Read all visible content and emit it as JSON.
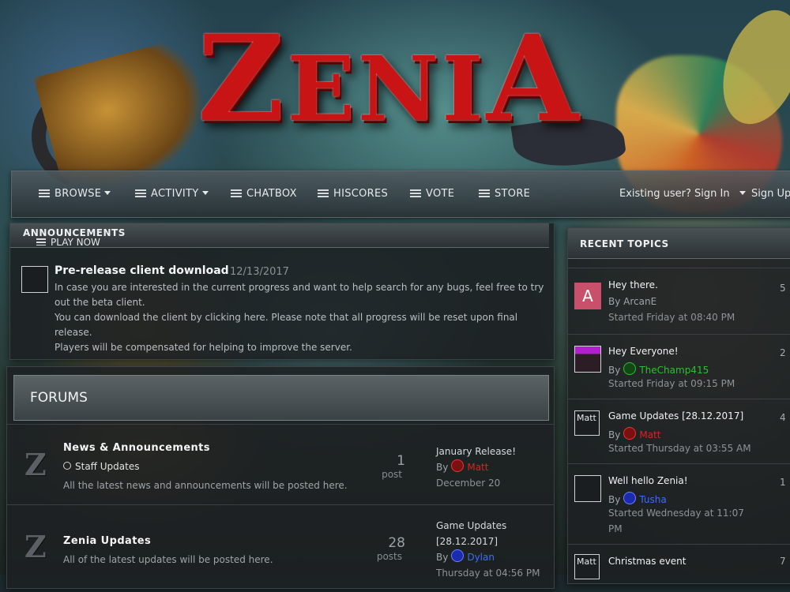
{
  "logo": {
    "text_z": "Z",
    "text_mid": "ENI",
    "text_a": "A"
  },
  "nav": {
    "items": [
      {
        "label": "BROWSE",
        "caret": true
      },
      {
        "label": "ACTIVITY",
        "caret": true
      },
      {
        "label": "CHATBOX",
        "caret": false
      },
      {
        "label": "HISCORES",
        "caret": false
      },
      {
        "label": "VOTE",
        "caret": false
      },
      {
        "label": "STORE",
        "caret": false
      }
    ],
    "sign_in": "Existing user? Sign In",
    "sign_up": "Sign Up"
  },
  "announcements": {
    "heading": "ANNOUNCEMENTS",
    "play_now": "PLAY NOW",
    "title": "Pre-release client download",
    "date": "12/13/2017",
    "body": [
      "In case you are interested in the current progress and want to help search for any bugs, feel free to try",
      "out the beta client.",
      "You can download the client by clicking here.   Please note that all progress will be reset upon final release.",
      "Players will be compensated for helping to improve the server."
    ]
  },
  "forums": {
    "heading": "FORUMS",
    "rows": [
      {
        "name": "News & Announcements",
        "sub": "Staff Updates",
        "desc": "All the latest news and announcements will be posted here.",
        "count": "1",
        "count_label": "post",
        "last_title": "January Release!",
        "last_by_prefix": "By",
        "last_by": "Matt",
        "last_by_color": "#e02020",
        "last_when": "December 20"
      },
      {
        "name": "Zenia Updates",
        "sub": "",
        "desc": "All of the latest updates will be posted here.",
        "count": "28",
        "count_label": "posts",
        "last_title_1": "Game Updates",
        "last_title_2": "[28.12.2017]",
        "last_by_prefix": "By",
        "last_by": "Dylan",
        "last_by_color": "#3a6cff",
        "last_when": "Thursday at 04:56 PM"
      }
    ]
  },
  "recent": {
    "heading": "RECENT TOPICS",
    "items": [
      {
        "avatar_letter": "A",
        "avatar_color": "#c9506a",
        "title": "Hey there.",
        "by_prefix": "By",
        "by": "ArcanE",
        "by_color": "#9ea5a9",
        "started": "Started Friday at 08:40 PM",
        "count": "5"
      },
      {
        "avatar_letter": "",
        "avatar_color": "#9b1fb4",
        "title": "Hey Everyone!",
        "by_prefix": "By",
        "by": "TheChamp415",
        "by_color": "#29c22d",
        "started": "Started Friday at 09:15 PM",
        "count": "2"
      },
      {
        "avatar_letter": "Matt",
        "avatar_color": "#1b1e20",
        "title": "Game Updates [28.12.2017]",
        "by_prefix": "By",
        "by": "Matt",
        "by_color": "#e02020",
        "started": "Started Thursday at 03:55 AM",
        "count": "4"
      },
      {
        "avatar_letter": "",
        "avatar_color": "#1b1e20",
        "title": "Well hello Zenia!",
        "by_prefix": "By",
        "by": "Tusha",
        "by_color": "#3a6cff",
        "started_1": "Started Wednesday at 11:07",
        "started_2": "PM",
        "count": "1"
      },
      {
        "avatar_letter": "Matt",
        "avatar_color": "#1b1e20",
        "title": "Christmas event",
        "count": "7"
      }
    ]
  }
}
